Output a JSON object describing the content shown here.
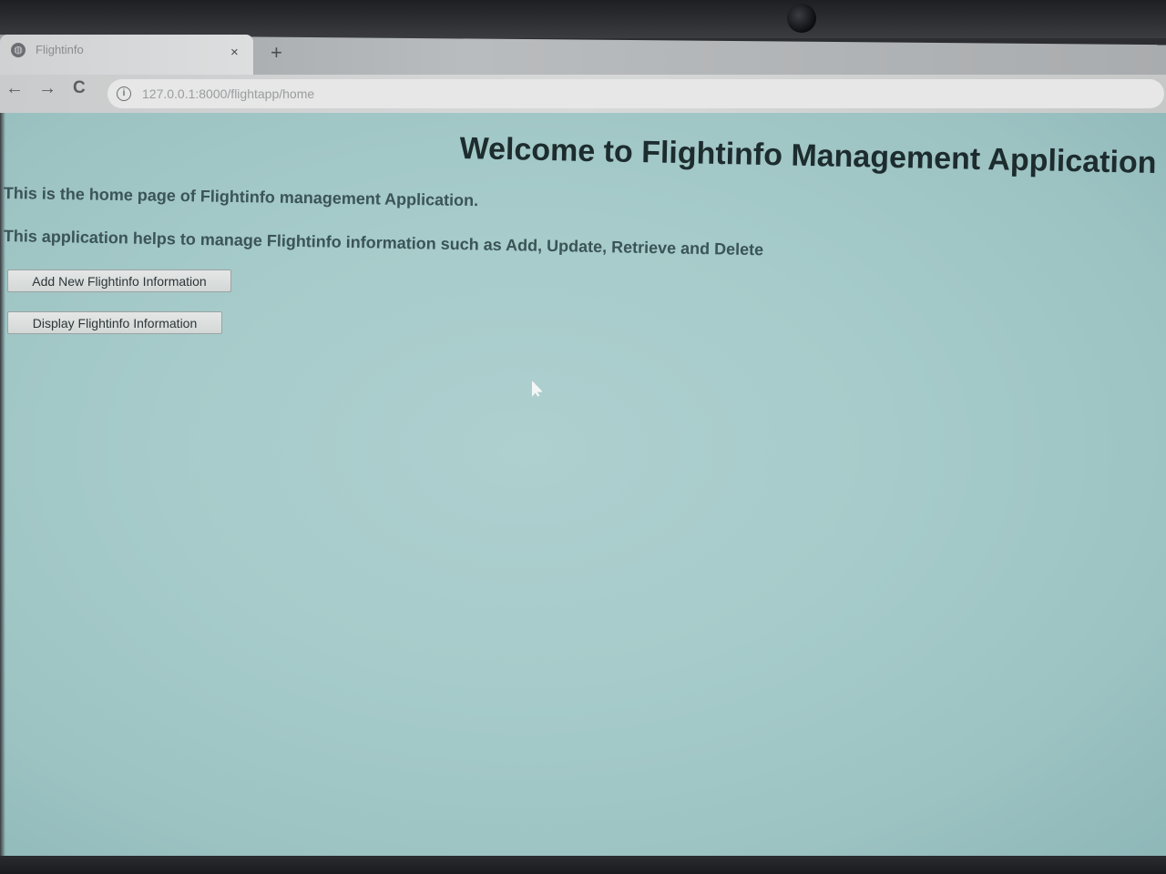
{
  "browser": {
    "tab_title": "Flightinfo",
    "tab_close": "×",
    "new_tab": "+",
    "back": "←",
    "forward": "→",
    "reload": "C",
    "url": "127.0.0.1:8000/flightapp/home"
  },
  "page": {
    "heading": "Welcome to Flightinfo Management Application",
    "intro": "This is the home page of Flightinfo management Application.",
    "description": "This application helps to manage Flightinfo information such as Add, Update, Retrieve and Delete",
    "buttons": {
      "add": "Add New Flightinfo Information",
      "display": "Display Flightinfo Information"
    }
  },
  "colors": {
    "page_background": "#a6cbca",
    "heading_text": "#1d2c2e",
    "body_text": "#3b5456"
  }
}
